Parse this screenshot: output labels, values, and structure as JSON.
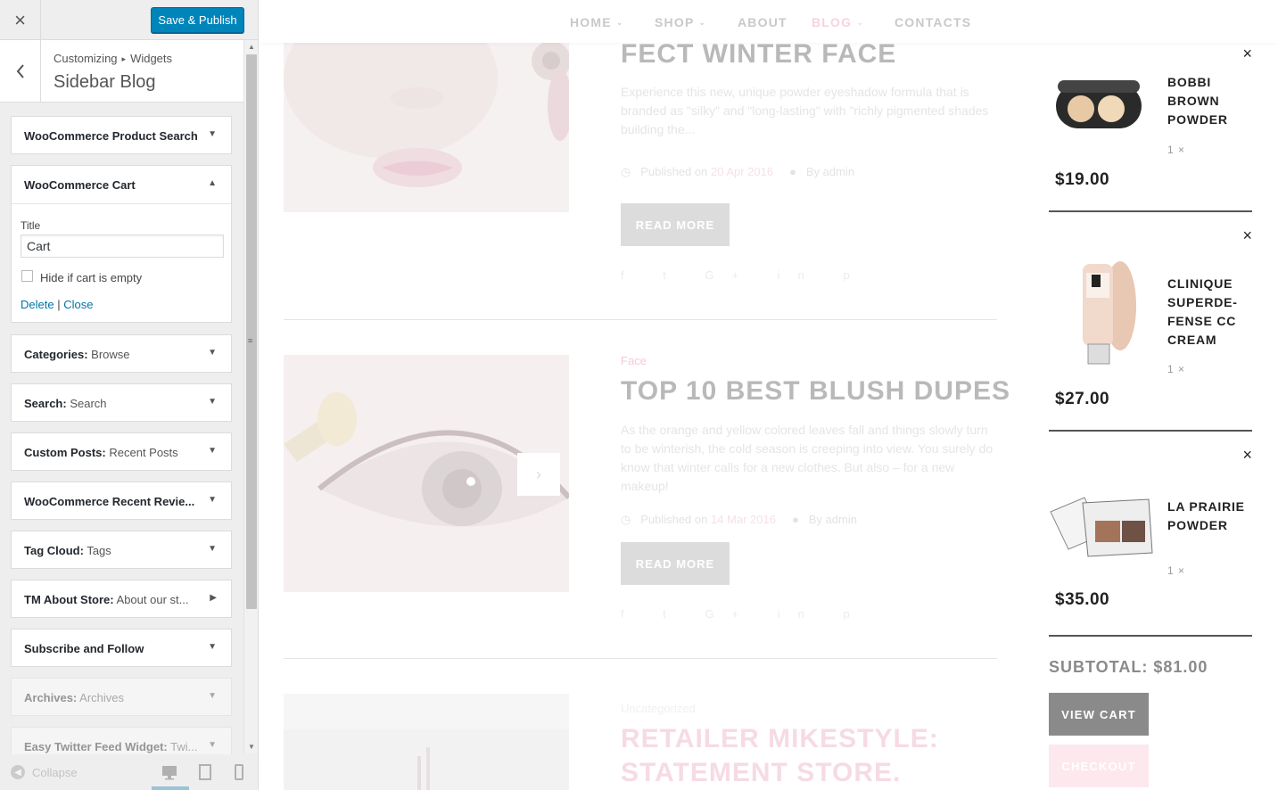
{
  "customizer": {
    "close_label": "×",
    "publish_label": "Save & Publish",
    "breadcrumb": [
      "Customizing",
      "Widgets"
    ],
    "breadcrumb_sep": "▸",
    "section_title": "Sidebar Blog",
    "footer": {
      "collapse_label": "Collapse"
    },
    "widgets": [
      {
        "name": "WooCommerce Product Search",
        "sub": ""
      },
      {
        "name": "Categories:",
        "sub": "Browse"
      },
      {
        "name": "Search:",
        "sub": "Search"
      },
      {
        "name": "Custom Posts:",
        "sub": "Recent Posts"
      },
      {
        "name": "WooCommerce Recent Revie...",
        "sub": ""
      },
      {
        "name": "Tag Cloud:",
        "sub": "Tags"
      },
      {
        "name": "TM About Store:",
        "sub": "About our st..."
      },
      {
        "name": "Subscribe and Follow",
        "sub": ""
      },
      {
        "name": "Archives:",
        "sub": "Archives"
      },
      {
        "name": "Easy Twitter Feed Widget:",
        "sub": "Twi..."
      }
    ],
    "cart_widget": {
      "name": "WooCommerce Cart",
      "title_label": "Title",
      "title_value": "Cart",
      "hide_label": "Hide if cart is empty",
      "delete_label": "Delete",
      "link_sep": "|",
      "close_label": "Close"
    }
  },
  "nav": {
    "home": "HOME",
    "shop": "SHOP",
    "about": "ABOUT",
    "blog": "BLOG",
    "contacts": "CONTACTS"
  },
  "posts": [
    {
      "title": "FECT WINTER FACE",
      "excerpt": "Experience this new, unique powder eyeshadow formula that is branded as \"silky\" and \"long-lasting\" with \"richly pigmented shades building the...",
      "published": "Published on",
      "date": "20 Apr 2016",
      "author": "By admin",
      "read_more": "READ MORE",
      "socials": "f t G+ in p"
    },
    {
      "category": "Face",
      "title": "TOP 10 BEST BLUSH DUPES",
      "excerpt": "As the orange and yellow colored leaves fall and things slowly turn to be winterish, the cold season is creeping into view. You surely do know that winter calls for a new clothes. But also – for a new makeup!",
      "published": "Published on",
      "date": "14 Mar 2016",
      "author": "By admin",
      "read_more": "READ MORE",
      "socials": "f t G+ in p"
    },
    {
      "category": "Uncategorized",
      "title_line1": "RETAILER MIKESTYLE:",
      "title_line2": "STATEMENT STORE."
    }
  ],
  "cart": {
    "items": [
      {
        "name": "BOBBI BROWN POWDER",
        "qty": "1 ×",
        "price": "$19.00"
      },
      {
        "name": "CLINIQUE SUPERDE-FENSE CC CREAM",
        "qty": "1 ×",
        "price": "$27.00"
      },
      {
        "name": "LA PRAIRIE POWDER",
        "qty": "1 ×",
        "price": "$35.00"
      }
    ],
    "subtotal_label": "SUBTOTAL:",
    "subtotal_value": "$81.00",
    "view_cart": "VIEW CART",
    "checkout": "CHECKOUT",
    "remove_label": "×"
  },
  "colors": {
    "publish_button": "#0085ba",
    "link": "#0073aa",
    "view_cart_bg": "#8a8a8a",
    "checkout_bg": "#fde8ee"
  }
}
